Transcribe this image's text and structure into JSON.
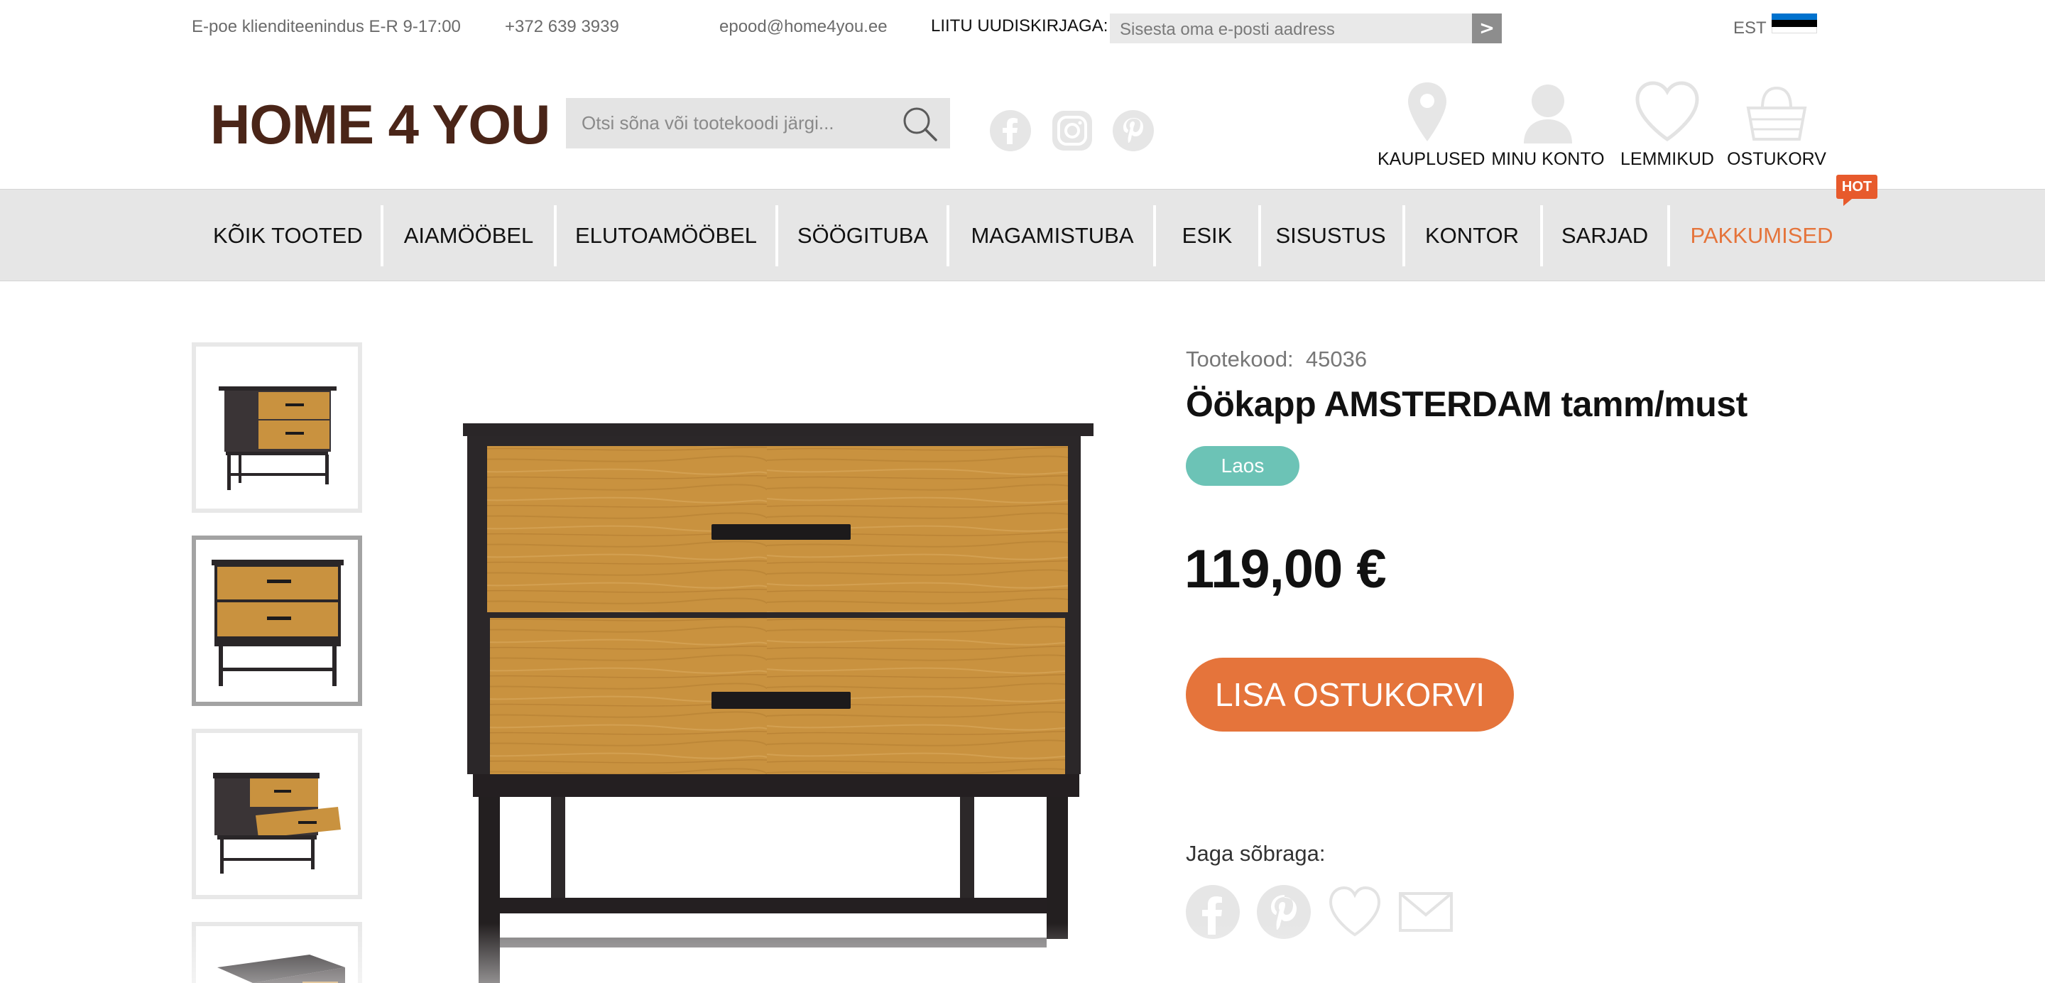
{
  "topbar": {
    "service_hours": "E-poe klienditeenindus E-R 9-17:00",
    "phone": "+372 639 3939",
    "email": "epood@home4you.ee",
    "newsletter_label": "LIITU UUDISKIRJAGA:",
    "newsletter_placeholder": "Sisesta oma e-posti aadress",
    "newsletter_submit": ">",
    "language": "EST",
    "flag_colors": [
      "#0072ce",
      "#000000",
      "#ffffff"
    ]
  },
  "header": {
    "logo_text": "HOME 4 YOU",
    "search_placeholder": "Otsi sõna või tootekoodi järgi...",
    "social_icons": [
      "facebook-icon",
      "instagram-icon",
      "pinterest-icon"
    ],
    "icons": [
      {
        "icon": "location-pin-icon",
        "label": "KAUPLUSED"
      },
      {
        "icon": "user-icon",
        "label": "MINU KONTO"
      },
      {
        "icon": "heart-icon",
        "label": "LEMMIKUD"
      },
      {
        "icon": "basket-icon",
        "label": "OSTUKORV"
      }
    ]
  },
  "nav": {
    "items": [
      "KÕIK TOOTED",
      "AIAMÖÖBEL",
      "ELUTOAMÖÖBEL",
      "SÖÖGITUBA",
      "MAGAMISTUBA",
      "ESIK",
      "SISUSTUS",
      "KONTOR",
      "SARJAD",
      "PAKKUMISED"
    ],
    "hot_badge": "HOT",
    "highlight_color": "#e5743b"
  },
  "product": {
    "code_label": "Tootekood:",
    "code_value": "45036",
    "title": "Öökapp AMSTERDAM tamm/must",
    "stock_badge": "Laos",
    "price": "119,00 €",
    "add_to_cart": "LISA OSTUKORVI",
    "share_label": "Jaga sõbraga:",
    "share_icons": [
      "facebook-icon",
      "pinterest-icon",
      "heart-icon",
      "mail-icon"
    ],
    "thumbnails": 4,
    "active_thumbnail": 2
  },
  "colors": {
    "accent": "#e5743b",
    "stock_badge": "#6cc3b6",
    "wood": "#c9923f",
    "frame": "#2a2628"
  }
}
